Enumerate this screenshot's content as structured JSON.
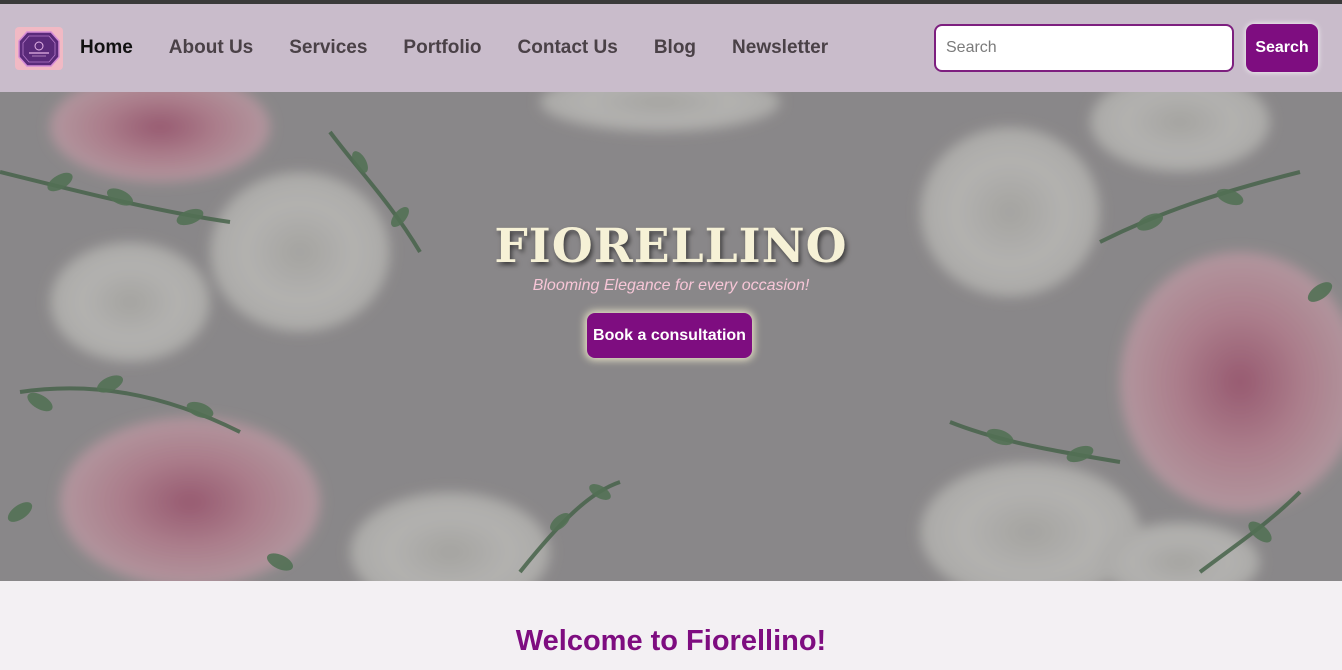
{
  "brand": {
    "logo_icon": "fiorellino-badge-logo"
  },
  "nav": {
    "items": [
      {
        "label": "Home",
        "active": true
      },
      {
        "label": "About Us"
      },
      {
        "label": "Services"
      },
      {
        "label": "Portfolio"
      },
      {
        "label": "Contact Us"
      },
      {
        "label": "Blog"
      },
      {
        "label": "Newsletter"
      }
    ]
  },
  "search": {
    "placeholder": "Search",
    "value": "",
    "button_label": "Search"
  },
  "hero": {
    "title": "FIORELLINO",
    "tagline": "Blooming Elegance for every occasion!",
    "cta_label": "Book a consultation",
    "background_icon": "floral-background-image"
  },
  "main": {
    "welcome_heading": "Welcome to Fiorellino!"
  },
  "colors": {
    "navbar_bg": "#c9bccb",
    "accent_purple": "#7e0d80",
    "title_cream": "#f6f1d6",
    "tagline_pink": "#f7c6d7",
    "page_bg": "#f3f0f3"
  }
}
